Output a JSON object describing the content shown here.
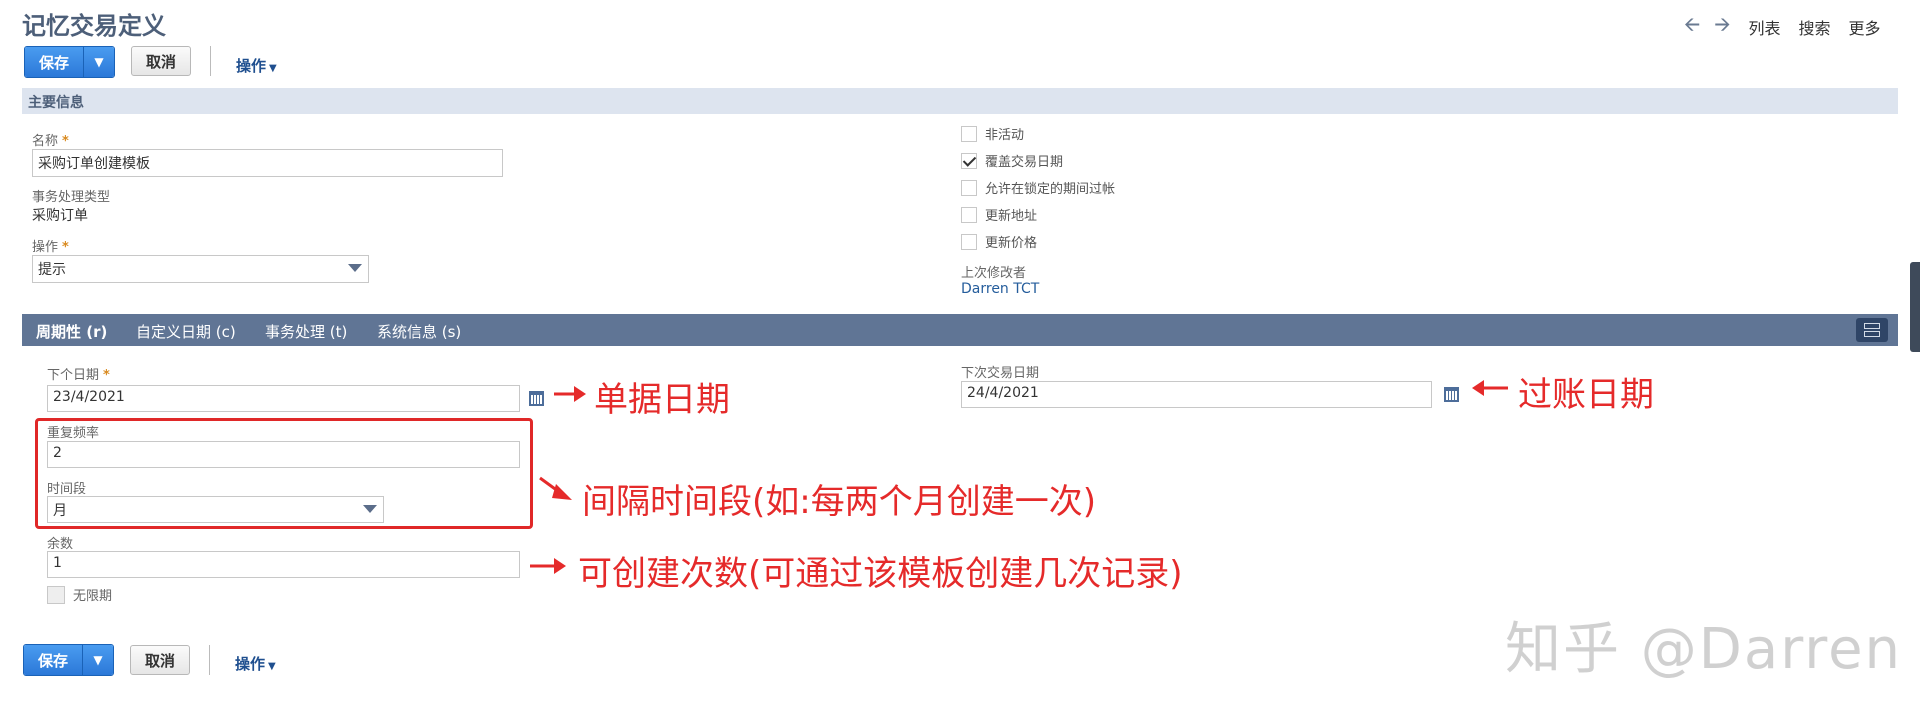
{
  "header": {
    "title": "记忆交易定义",
    "nav_list": "列表",
    "nav_search": "搜索",
    "nav_more": "更多"
  },
  "toolbar": {
    "save_label": "保存",
    "cancel_label": "取消",
    "actions_label": "操作"
  },
  "main_info": {
    "section_title": "主要信息",
    "name_label": "名称",
    "name_value": "采购订单创建模板",
    "txn_type_label": "事务处理类型",
    "txn_type_value": "采购订单",
    "action_label": "操作",
    "action_value": "提示",
    "checkboxes": [
      {
        "label": "非活动",
        "checked": false
      },
      {
        "label": "覆盖交易日期",
        "checked": true
      },
      {
        "label": "允许在锁定的期间过帐",
        "checked": false
      },
      {
        "label": "更新地址",
        "checked": false
      },
      {
        "label": "更新价格",
        "checked": false
      }
    ],
    "last_modified_label": "上次修改者",
    "last_modified_value": "Darren TCT"
  },
  "tabs": [
    {
      "label": "周期性 (r)",
      "active": true
    },
    {
      "label": "自定义日期 (c)",
      "active": false
    },
    {
      "label": "事务处理 (t)",
      "active": false
    },
    {
      "label": "系统信息 (s)",
      "active": false
    }
  ],
  "recurrence": {
    "next_date_label": "下个日期",
    "next_date_value": "23/4/2021",
    "next_txn_date_label": "下次交易日期",
    "next_txn_date_value": "24/4/2021",
    "frequency_label": "重复频率",
    "frequency_value": "2",
    "period_label": "时间段",
    "period_value": "月",
    "remaining_label": "余数",
    "remaining_value": "1",
    "unlimited_label": "无限期"
  },
  "annotations": {
    "doc_date": "单据日期",
    "posting_date": "过账日期",
    "interval": "间隔时间段(如:每两个月创建一次)",
    "count": "可创建次数(可通过该模板创建几次记录)"
  },
  "watermark": "知乎 @Darren",
  "colors": {
    "accent_blue": "#2b78d8",
    "tab_bar": "#607595",
    "section_bar": "#dde4ef",
    "annotation_red": "#e52a2a"
  }
}
